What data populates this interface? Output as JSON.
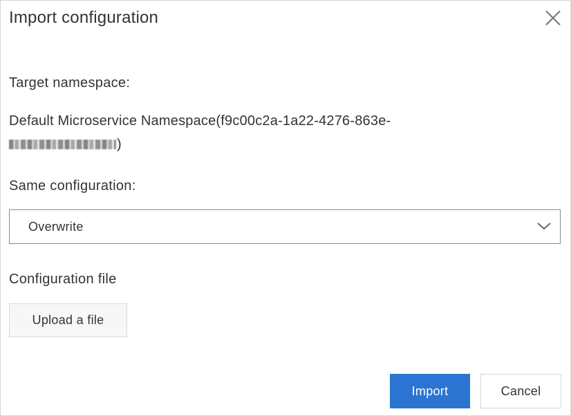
{
  "dialog": {
    "title": "Import configuration",
    "close_icon": "close-icon"
  },
  "target_namespace": {
    "label": "Target namespace:",
    "value_line1": "Default Microservice Namespace(f9c00c2a-1a22-4276-863e-",
    "value_line2_end": ")"
  },
  "same_configuration": {
    "label": "Same configuration:",
    "selected": "Overwrite",
    "icon": "chevron-down-icon"
  },
  "configuration_file": {
    "label": "Configuration file",
    "upload_label": "Upload a file"
  },
  "footer": {
    "import_label": "Import",
    "cancel_label": "Cancel"
  },
  "colors": {
    "primary": "#2b74d1",
    "text": "#333333",
    "border": "#d6d6d6"
  }
}
